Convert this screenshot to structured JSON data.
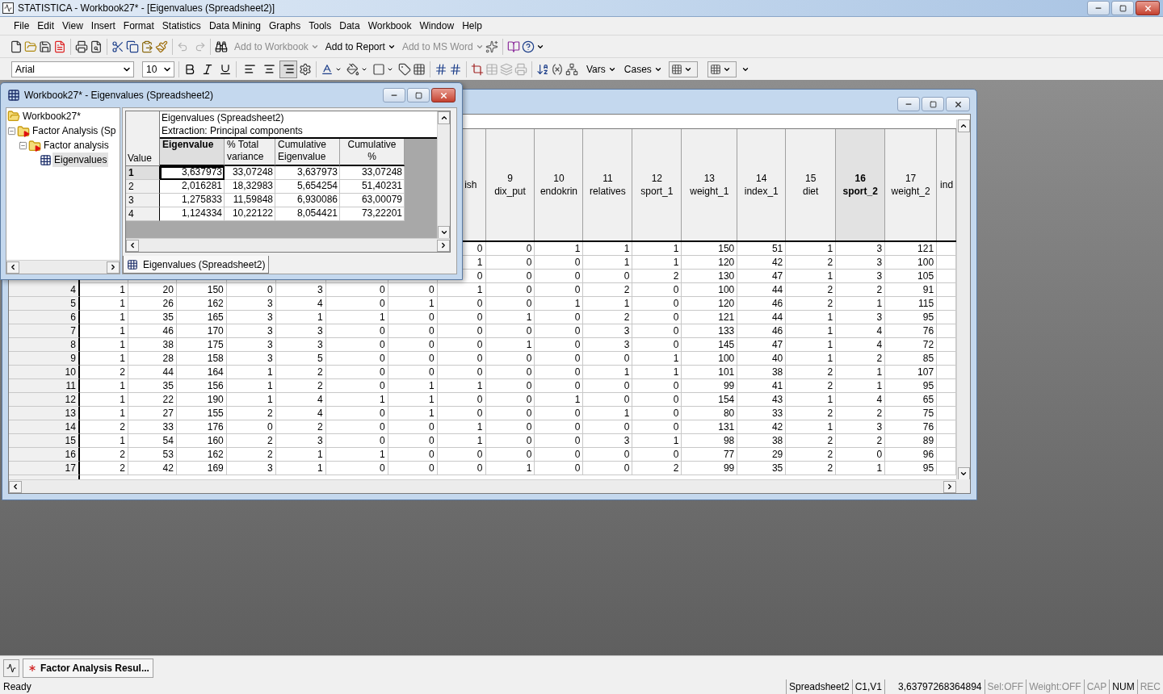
{
  "title_bar": {
    "title": "STATISTICA - Workbook27* - [Eigenvalues (Spreadsheet2)]"
  },
  "menu": [
    "File",
    "Edit",
    "View",
    "Insert",
    "Format",
    "Statistics",
    "Data Mining",
    "Graphs",
    "Tools",
    "Data",
    "Workbook",
    "Window",
    "Help"
  ],
  "toolbar": {
    "history": [
      {
        "disabled": true
      },
      {
        "disabled": true
      }
    ],
    "output_buttons": [
      {
        "label": "Add to Workbook",
        "disabled": true
      },
      {
        "label": "Add to Report",
        "disabled": false
      },
      {
        "label": "Add to MS Word",
        "disabled": true
      }
    ]
  },
  "format_bar": {
    "font": "Arial",
    "size": "10",
    "alignment": [
      {
        "selected": false
      },
      {
        "selected": false
      },
      {
        "selected": true
      }
    ],
    "menus": [
      "Vars",
      "Cases"
    ]
  },
  "workbook_window": {
    "title": "Workbook27* - Eigenvalues (Spreadsheet2)",
    "tree": [
      {
        "label": "Workbook27*",
        "kind": "workbook",
        "selected": false,
        "expanded": true,
        "children": [
          {
            "label": "Factor Analysis (Sp",
            "kind": "analysis",
            "selected": false,
            "expanded": true,
            "children": [
              {
                "label": "Factor analysis",
                "kind": "analysis",
                "selected": false,
                "expanded": true,
                "children": [
                  {
                    "label": "Eigenvalues",
                    "kind": "spreadsheet",
                    "selected": true
                  }
                ]
              }
            ]
          }
        ]
      }
    ],
    "sheet": {
      "title_lines": [
        "Eigenvalues (Spreadsheet2)",
        "Extraction: Principal components"
      ],
      "corner": "Value",
      "columns": [
        {
          "lines": [
            "Eigenvalue"
          ],
          "selected": true
        },
        {
          "lines": [
            "% Total",
            "variance"
          ],
          "selected": false
        },
        {
          "lines": [
            "Cumulative",
            "Eigenvalue"
          ],
          "selected": false
        },
        {
          "lines": [
            "Cumulative",
            "%"
          ],
          "selected": false
        }
      ],
      "rows": [
        {
          "label": "1",
          "selected": true,
          "values": [
            "3,637973",
            "33,07248",
            "3,637973",
            "33,07248"
          ]
        },
        {
          "label": "2",
          "selected": false,
          "values": [
            "2,016281",
            "18,32983",
            "5,654254",
            "51,40231"
          ]
        },
        {
          "label": "3",
          "selected": false,
          "values": [
            "1,275833",
            "11,59848",
            "6,930086",
            "63,00079"
          ]
        },
        {
          "label": "4",
          "selected": false,
          "values": [
            "1,124334",
            "10,22122",
            "8,054421",
            "73,22201"
          ]
        }
      ]
    },
    "tab": "Eigenvalues (Spreadsheet2)"
  },
  "spreadsheet": {
    "columns": [
      null,
      null,
      null,
      null,
      null,
      null,
      null,
      {
        "name": "ish",
        "selected": false
      },
      {
        "number": "9",
        "name": "dix_put",
        "selected": false
      },
      {
        "number": "10",
        "name": "endokrin",
        "selected": false
      },
      {
        "number": "11",
        "name": "relatives",
        "selected": false
      },
      {
        "number": "12",
        "name": "sport_1",
        "selected": false
      },
      {
        "number": "13",
        "name": "weight_1",
        "selected": false
      },
      {
        "number": "14",
        "name": "index_1",
        "selected": false
      },
      {
        "number": "15",
        "name": "diet",
        "selected": false
      },
      {
        "number": "16",
        "name": "sport_2",
        "selected": true
      },
      {
        "number": "17",
        "name": "weight_2",
        "selected": false
      },
      {
        "name": "ind",
        "selected": false
      }
    ],
    "rows": [
      {
        "cells": [
          null,
          null,
          null,
          null,
          null,
          null,
          null,
          "0",
          "0",
          "1",
          "1",
          "1",
          "150",
          "51",
          "1",
          "3",
          "121"
        ]
      },
      {
        "cells": [
          null,
          null,
          null,
          null,
          null,
          null,
          null,
          "1",
          "0",
          "0",
          "1",
          "1",
          "120",
          "42",
          "2",
          "3",
          "100"
        ]
      },
      {
        "cells": [
          null,
          null,
          null,
          null,
          null,
          null,
          null,
          "0",
          "0",
          "0",
          "0",
          "2",
          "130",
          "47",
          "1",
          "3",
          "105"
        ]
      },
      {
        "label": "4",
        "cells": [
          "1",
          "20",
          "150",
          "0",
          "3",
          "0",
          "0",
          "1",
          "0",
          "0",
          "2",
          "0",
          "100",
          "44",
          "2",
          "2",
          "91"
        ]
      },
      {
        "label": "5",
        "cells": [
          "1",
          "26",
          "162",
          "3",
          "4",
          "0",
          "1",
          "0",
          "0",
          "1",
          "1",
          "0",
          "120",
          "46",
          "2",
          "1",
          "115"
        ]
      },
      {
        "label": "6",
        "cells": [
          "1",
          "35",
          "165",
          "3",
          "1",
          "1",
          "0",
          "0",
          "1",
          "0",
          "2",
          "0",
          "121",
          "44",
          "1",
          "3",
          "95"
        ]
      },
      {
        "label": "7",
        "cells": [
          "1",
          "46",
          "170",
          "3",
          "3",
          "0",
          "0",
          "0",
          "0",
          "0",
          "3",
          "0",
          "133",
          "46",
          "1",
          "4",
          "76"
        ]
      },
      {
        "label": "8",
        "cells": [
          "1",
          "38",
          "175",
          "3",
          "3",
          "0",
          "0",
          "0",
          "1",
          "0",
          "3",
          "0",
          "145",
          "47",
          "1",
          "4",
          "72"
        ]
      },
      {
        "label": "9",
        "cells": [
          "1",
          "28",
          "158",
          "3",
          "5",
          "0",
          "0",
          "0",
          "0",
          "0",
          "0",
          "1",
          "100",
          "40",
          "1",
          "2",
          "85"
        ]
      },
      {
        "label": "10",
        "cells": [
          "2",
          "44",
          "164",
          "1",
          "2",
          "0",
          "0",
          "0",
          "0",
          "0",
          "1",
          "1",
          "101",
          "38",
          "2",
          "1",
          "107"
        ]
      },
      {
        "label": "11",
        "cells": [
          "1",
          "35",
          "156",
          "1",
          "2",
          "0",
          "1",
          "1",
          "0",
          "0",
          "0",
          "0",
          "99",
          "41",
          "2",
          "1",
          "95"
        ]
      },
      {
        "label": "12",
        "cells": [
          "1",
          "22",
          "190",
          "1",
          "4",
          "1",
          "1",
          "0",
          "0",
          "1",
          "0",
          "0",
          "154",
          "43",
          "1",
          "4",
          "65"
        ]
      },
      {
        "label": "13",
        "cells": [
          "1",
          "27",
          "155",
          "2",
          "4",
          "0",
          "1",
          "0",
          "0",
          "0",
          "1",
          "0",
          "80",
          "33",
          "2",
          "2",
          "75"
        ]
      },
      {
        "label": "14",
        "cells": [
          "2",
          "33",
          "176",
          "0",
          "2",
          "0",
          "0",
          "1",
          "0",
          "0",
          "0",
          "0",
          "131",
          "42",
          "1",
          "3",
          "76"
        ]
      },
      {
        "label": "15",
        "cells": [
          "1",
          "54",
          "160",
          "2",
          "3",
          "0",
          "0",
          "1",
          "0",
          "0",
          "3",
          "1",
          "98",
          "38",
          "2",
          "2",
          "89"
        ]
      },
      {
        "label": "16",
        "cells": [
          "2",
          "53",
          "162",
          "2",
          "1",
          "1",
          "0",
          "0",
          "0",
          "0",
          "0",
          "0",
          "77",
          "29",
          "2",
          "0",
          "96"
        ]
      },
      {
        "label": "17",
        "cells": [
          "2",
          "42",
          "169",
          "3",
          "1",
          "0",
          "0",
          "0",
          "1",
          "0",
          "0",
          "2",
          "99",
          "35",
          "2",
          "1",
          "95"
        ]
      }
    ]
  },
  "taskbar": [
    {
      "label": "Factor Analysis Resul..."
    }
  ],
  "status_bar": {
    "message": "Ready",
    "panes": [
      {
        "text": "Spreadsheet2",
        "active": true
      },
      {
        "text": "C1,V1",
        "active": true
      },
      {
        "text": "3,63797268364894",
        "active": true
      },
      {
        "text": "Sel:OFF",
        "active": false
      },
      {
        "text": "Weight:OFF",
        "active": false
      },
      {
        "text": "CAP",
        "active": false
      },
      {
        "text": "NUM",
        "active": true
      },
      {
        "text": "REC",
        "active": false
      }
    ]
  }
}
